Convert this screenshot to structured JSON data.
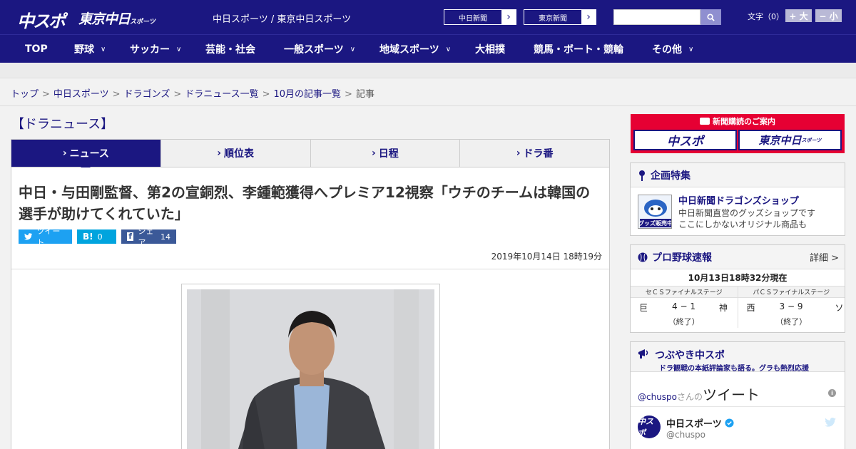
{
  "header": {
    "logo_chuspo": "中スポ",
    "logo_tokyo": "東京中日",
    "logo_tokyo_small": "スポーツ",
    "site_sub": "中日スポーツ / 東京中日スポーツ",
    "ext_links": [
      {
        "label": "中日新聞"
      },
      {
        "label": "東京新聞"
      }
    ],
    "search_placeholder": "",
    "font_size_label": "文字（0）",
    "font_plus": "+ 大",
    "font_minus": "− 小"
  },
  "nav": {
    "items": [
      {
        "label": "TOP",
        "has_menu": false
      },
      {
        "label": "野球",
        "has_menu": true
      },
      {
        "label": "サッカー",
        "has_menu": true
      },
      {
        "label": "芸能・社会",
        "has_menu": false
      },
      {
        "label": "一般スポーツ",
        "has_menu": true
      },
      {
        "label": "地域スポーツ",
        "has_menu": true
      },
      {
        "label": "大相撲",
        "has_menu": false
      },
      {
        "label": "競馬・ボート・競輪",
        "has_menu": false
      },
      {
        "label": "その他",
        "has_menu": true
      }
    ]
  },
  "breadcrumb": {
    "items": [
      "トップ",
      "中日スポーツ",
      "ドラゴンズ",
      "ドラニュース一覧",
      "10月の記事一覧"
    ],
    "current": "記事"
  },
  "section": {
    "title": "【ドラニュース】",
    "tabs": [
      "ニュース",
      "順位表",
      "日程",
      "ドラ番"
    ],
    "active_tab": 0
  },
  "article": {
    "headline": "中日・与田剛監督、第2の宣銅烈、李鍾範獲得へプレミア12視察「ウチのチームは韓国の選手が助けてくれていた」",
    "share": {
      "tweet_label": "ツイート",
      "hatena_label": "B!",
      "hatena_count": "0",
      "facebook_label": "シェア",
      "facebook_count": "14"
    },
    "date": "2019年10月14日 18時19分"
  },
  "sidebar": {
    "ad": {
      "title": "新聞購読のご案内",
      "logo_left": "中スポ",
      "logo_right": "東京中日",
      "logo_right_small": "スポーツ"
    },
    "feature": {
      "title": "企画特集",
      "thumb_text": "グッズ販売中",
      "item_title": "中日新聞ドラゴンズショップ",
      "item_desc_1": "中日新聞直営のグッズショップです",
      "item_desc_2": "ここにしかないオリジナル商品も"
    },
    "scores": {
      "title": "プロ野球速報",
      "more": "詳細 >",
      "time": "10月13日18時32分現在",
      "games": [
        {
          "stage": "セＣＳファイナルステージ",
          "home": "巨",
          "score": "4 − 1",
          "away": "神",
          "status": "（終了）"
        },
        {
          "stage": "パＣＳファイナルステージ",
          "home": "西",
          "score": "3 − 9",
          "away": "ソ",
          "status": "（終了）"
        }
      ]
    },
    "tweets": {
      "title": "つぶやき中スポ",
      "subtitle": "ドラ観戦の本紙評論家も語る。グラも熱烈応援",
      "handle_link": "@chuspo",
      "san": "さんの",
      "big": "ツイート",
      "avatar_text": "中スポ",
      "name": "中日スポーツ",
      "handle": "@chuspo"
    }
  },
  "colors": {
    "brand": "#1b1781",
    "ad_red": "#e60033",
    "twitter": "#1da1f2",
    "hatena": "#00a4de",
    "facebook": "#3b5998"
  }
}
